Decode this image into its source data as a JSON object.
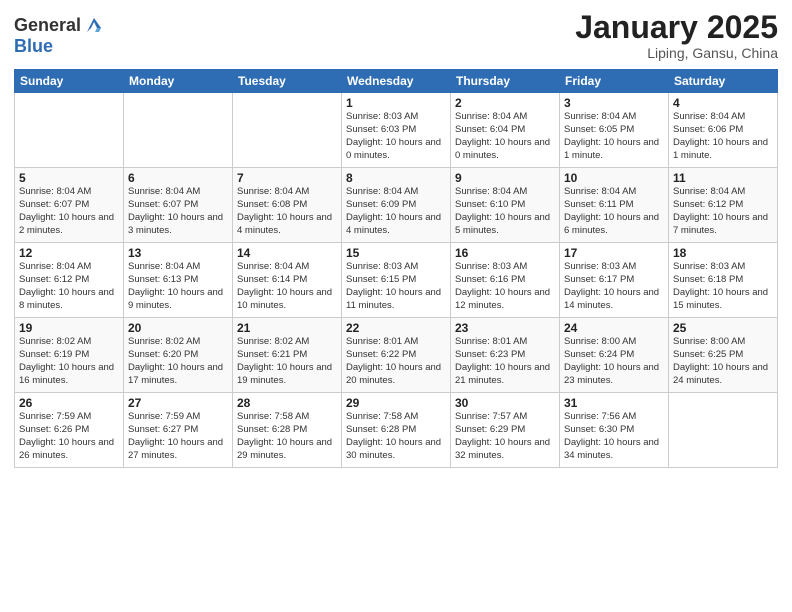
{
  "header": {
    "logo_general": "General",
    "logo_blue": "Blue",
    "month": "January 2025",
    "location": "Liping, Gansu, China"
  },
  "weekdays": [
    "Sunday",
    "Monday",
    "Tuesday",
    "Wednesday",
    "Thursday",
    "Friday",
    "Saturday"
  ],
  "weeks": [
    [
      {
        "day": "",
        "info": ""
      },
      {
        "day": "",
        "info": ""
      },
      {
        "day": "",
        "info": ""
      },
      {
        "day": "1",
        "info": "Sunrise: 8:03 AM\nSunset: 6:03 PM\nDaylight: 10 hours\nand 0 minutes."
      },
      {
        "day": "2",
        "info": "Sunrise: 8:04 AM\nSunset: 6:04 PM\nDaylight: 10 hours\nand 0 minutes."
      },
      {
        "day": "3",
        "info": "Sunrise: 8:04 AM\nSunset: 6:05 PM\nDaylight: 10 hours\nand 1 minute."
      },
      {
        "day": "4",
        "info": "Sunrise: 8:04 AM\nSunset: 6:06 PM\nDaylight: 10 hours\nand 1 minute."
      }
    ],
    [
      {
        "day": "5",
        "info": "Sunrise: 8:04 AM\nSunset: 6:07 PM\nDaylight: 10 hours\nand 2 minutes."
      },
      {
        "day": "6",
        "info": "Sunrise: 8:04 AM\nSunset: 6:07 PM\nDaylight: 10 hours\nand 3 minutes."
      },
      {
        "day": "7",
        "info": "Sunrise: 8:04 AM\nSunset: 6:08 PM\nDaylight: 10 hours\nand 4 minutes."
      },
      {
        "day": "8",
        "info": "Sunrise: 8:04 AM\nSunset: 6:09 PM\nDaylight: 10 hours\nand 4 minutes."
      },
      {
        "day": "9",
        "info": "Sunrise: 8:04 AM\nSunset: 6:10 PM\nDaylight: 10 hours\nand 5 minutes."
      },
      {
        "day": "10",
        "info": "Sunrise: 8:04 AM\nSunset: 6:11 PM\nDaylight: 10 hours\nand 6 minutes."
      },
      {
        "day": "11",
        "info": "Sunrise: 8:04 AM\nSunset: 6:12 PM\nDaylight: 10 hours\nand 7 minutes."
      }
    ],
    [
      {
        "day": "12",
        "info": "Sunrise: 8:04 AM\nSunset: 6:12 PM\nDaylight: 10 hours\nand 8 minutes."
      },
      {
        "day": "13",
        "info": "Sunrise: 8:04 AM\nSunset: 6:13 PM\nDaylight: 10 hours\nand 9 minutes."
      },
      {
        "day": "14",
        "info": "Sunrise: 8:04 AM\nSunset: 6:14 PM\nDaylight: 10 hours\nand 10 minutes."
      },
      {
        "day": "15",
        "info": "Sunrise: 8:03 AM\nSunset: 6:15 PM\nDaylight: 10 hours\nand 11 minutes."
      },
      {
        "day": "16",
        "info": "Sunrise: 8:03 AM\nSunset: 6:16 PM\nDaylight: 10 hours\nand 12 minutes."
      },
      {
        "day": "17",
        "info": "Sunrise: 8:03 AM\nSunset: 6:17 PM\nDaylight: 10 hours\nand 14 minutes."
      },
      {
        "day": "18",
        "info": "Sunrise: 8:03 AM\nSunset: 6:18 PM\nDaylight: 10 hours\nand 15 minutes."
      }
    ],
    [
      {
        "day": "19",
        "info": "Sunrise: 8:02 AM\nSunset: 6:19 PM\nDaylight: 10 hours\nand 16 minutes."
      },
      {
        "day": "20",
        "info": "Sunrise: 8:02 AM\nSunset: 6:20 PM\nDaylight: 10 hours\nand 17 minutes."
      },
      {
        "day": "21",
        "info": "Sunrise: 8:02 AM\nSunset: 6:21 PM\nDaylight: 10 hours\nand 19 minutes."
      },
      {
        "day": "22",
        "info": "Sunrise: 8:01 AM\nSunset: 6:22 PM\nDaylight: 10 hours\nand 20 minutes."
      },
      {
        "day": "23",
        "info": "Sunrise: 8:01 AM\nSunset: 6:23 PM\nDaylight: 10 hours\nand 21 minutes."
      },
      {
        "day": "24",
        "info": "Sunrise: 8:00 AM\nSunset: 6:24 PM\nDaylight: 10 hours\nand 23 minutes."
      },
      {
        "day": "25",
        "info": "Sunrise: 8:00 AM\nSunset: 6:25 PM\nDaylight: 10 hours\nand 24 minutes."
      }
    ],
    [
      {
        "day": "26",
        "info": "Sunrise: 7:59 AM\nSunset: 6:26 PM\nDaylight: 10 hours\nand 26 minutes."
      },
      {
        "day": "27",
        "info": "Sunrise: 7:59 AM\nSunset: 6:27 PM\nDaylight: 10 hours\nand 27 minutes."
      },
      {
        "day": "28",
        "info": "Sunrise: 7:58 AM\nSunset: 6:28 PM\nDaylight: 10 hours\nand 29 minutes."
      },
      {
        "day": "29",
        "info": "Sunrise: 7:58 AM\nSunset: 6:28 PM\nDaylight: 10 hours\nand 30 minutes."
      },
      {
        "day": "30",
        "info": "Sunrise: 7:57 AM\nSunset: 6:29 PM\nDaylight: 10 hours\nand 32 minutes."
      },
      {
        "day": "31",
        "info": "Sunrise: 7:56 AM\nSunset: 6:30 PM\nDaylight: 10 hours\nand 34 minutes."
      },
      {
        "day": "",
        "info": ""
      }
    ]
  ]
}
